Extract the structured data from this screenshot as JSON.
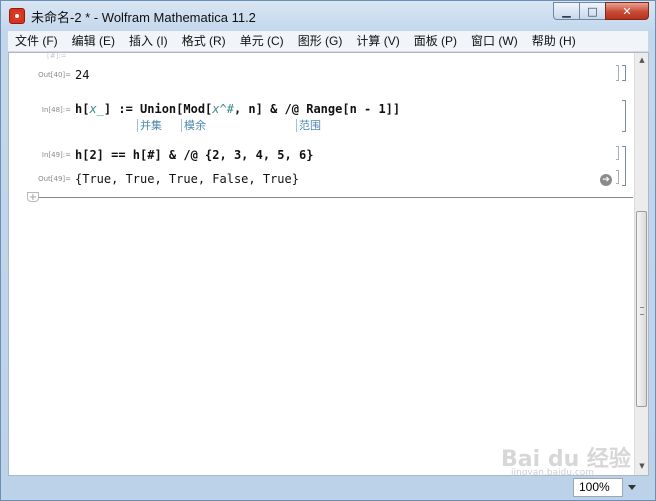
{
  "window": {
    "title": "未命名-2 * - Wolfram Mathematica 11.2",
    "minimize": "▁",
    "maximize": "□",
    "close": "✕"
  },
  "menu": [
    "文件 (F)",
    "编辑 (E)",
    "插入 (I)",
    "格式 (R)",
    "单元 (C)",
    "图形 (G)",
    "计算 (V)",
    "面板 (P)",
    "窗口 (W)",
    "帮助 (H)"
  ],
  "cells": {
    "cut_label": "[#]:=",
    "out40": {
      "label": "Out[40]=",
      "value": "24"
    },
    "in48": {
      "label": "In[48]:=",
      "parts": {
        "a": "h[",
        "var1": "x_",
        "b": "] := Union[Mod[",
        "var2": "x^#",
        "c": ", n] & /@ Range[n - 1]]"
      },
      "hints": [
        "并集",
        "模余",
        "范围"
      ]
    },
    "in49": {
      "label": "In[49]:=",
      "code": "h[2] == h[#] & /@ {2, 3, 4, 5, 6}"
    },
    "out49": {
      "label": "Out[49]=",
      "value": "{True, True, True, False, True}"
    }
  },
  "statusbar": {
    "zoom": "100%"
  },
  "watermark": {
    "brand": "Bai du 经验",
    "url": "jingyan.baidu.com"
  },
  "icons": {
    "app": "mathematica-icon",
    "more_info": "arrow-circle-icon",
    "insert": "plus-icon"
  }
}
